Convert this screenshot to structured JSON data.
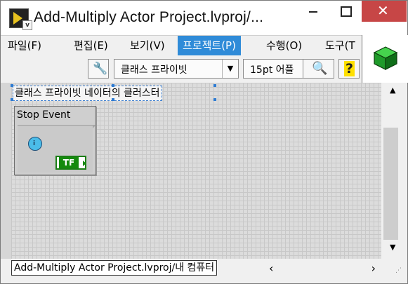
{
  "window": {
    "title": "Add-Multiply Actor Project.lvproj/...",
    "controls": {
      "minimize": "minimize",
      "maximize": "maximize",
      "close": "✕"
    }
  },
  "menubar": {
    "items": [
      {
        "label": "파일(F)"
      },
      {
        "label": "편집(E)"
      },
      {
        "label": "보기(V)"
      },
      {
        "label": "프로젝트(P)",
        "active": true
      },
      {
        "label": "수행(O)"
      },
      {
        "label": "도구(T"
      }
    ]
  },
  "toolbar": {
    "class_combo": "클래스 프라이빗",
    "font_combo": "15pt 어플",
    "icons": [
      "wrench-icon",
      "dropdown-arrow-icon",
      "search-icon",
      "help-icon"
    ]
  },
  "canvas": {
    "label": "클래스 프라이빗 네이터의 클러스터",
    "event_structure": {
      "header": "Stop Event",
      "terminal": "TF"
    }
  },
  "statusbar": {
    "path": "Add-Multiply Actor Project.lvproj/내 컴퓨터"
  },
  "colors": {
    "accent": "#2f8bd8",
    "close": "#c74646",
    "boolean": "#158a0d"
  }
}
